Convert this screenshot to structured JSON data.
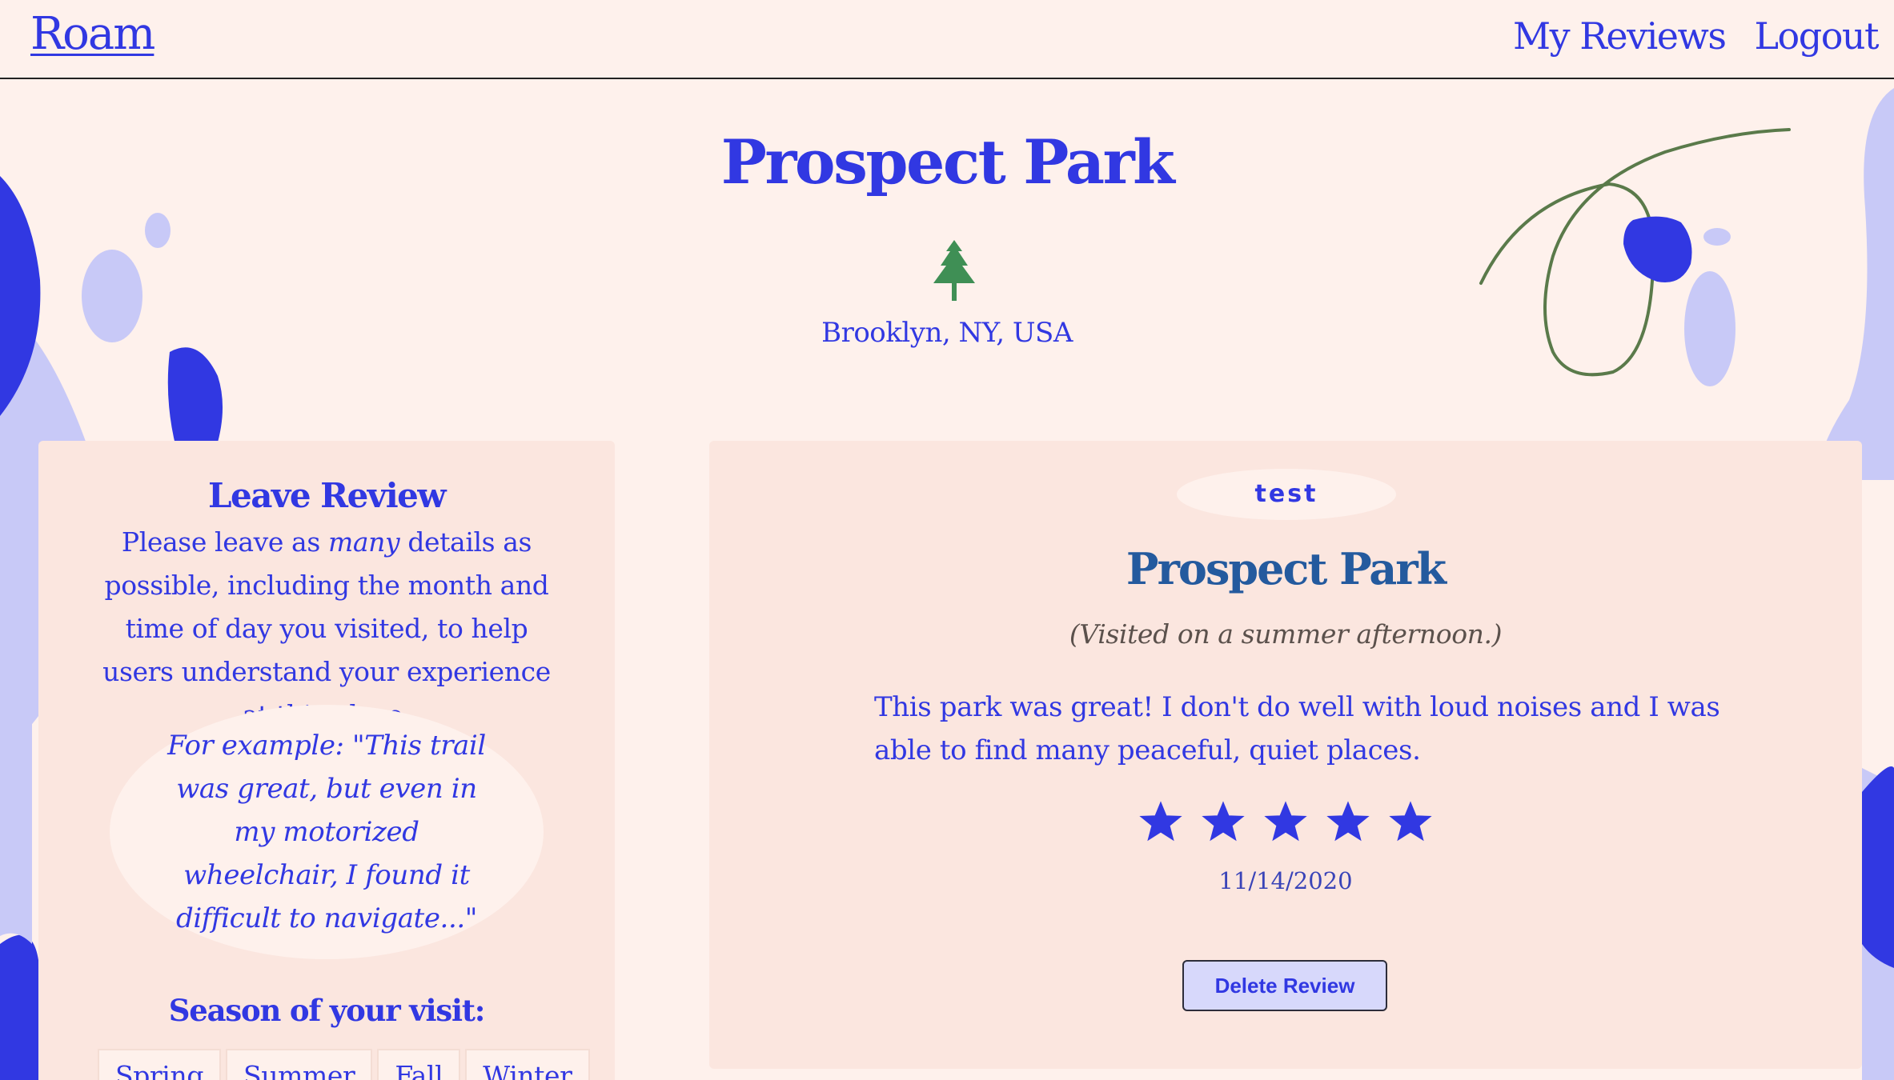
{
  "nav": {
    "logo": "Roam",
    "links": [
      {
        "label": "My Reviews"
      },
      {
        "label": "Logout"
      }
    ]
  },
  "place": {
    "name": "Prospect Park",
    "location": "Brooklyn, NY, USA",
    "icon": "tree-icon"
  },
  "leave_review": {
    "heading": "Leave Review",
    "instructions_before": "Please leave as ",
    "instructions_emphasis": "many",
    "instructions_after": " details as possible, including the month and time of day you visited, to help users understand your experience at this place.",
    "example": "For example: \"This trail was great, but even in my motorized wheelchair, I found it difficult to navigate...\"",
    "season_heading": "Season of your visit:",
    "seasons": [
      "Spring",
      "Summer",
      "Fall",
      "Winter"
    ]
  },
  "review": {
    "username": "test",
    "place_name": "Prospect Park",
    "visited_note": "(Visited on a summer afternoon.)",
    "body": "This park was great! I don't do well with loud noises and I was able to find many peaceful, quiet places.",
    "rating": 5,
    "rating_max": 5,
    "date": "11/14/2020",
    "delete_label": "Delete Review"
  },
  "colors": {
    "background": "#fef1ec",
    "panel": "#fbe6df",
    "accent_blue": "#3138e2",
    "light_blue": "#c8c9f7",
    "tree_green": "#3f8f55",
    "squiggle_green": "#5a7a4a",
    "title_blue": "#245a9e"
  }
}
